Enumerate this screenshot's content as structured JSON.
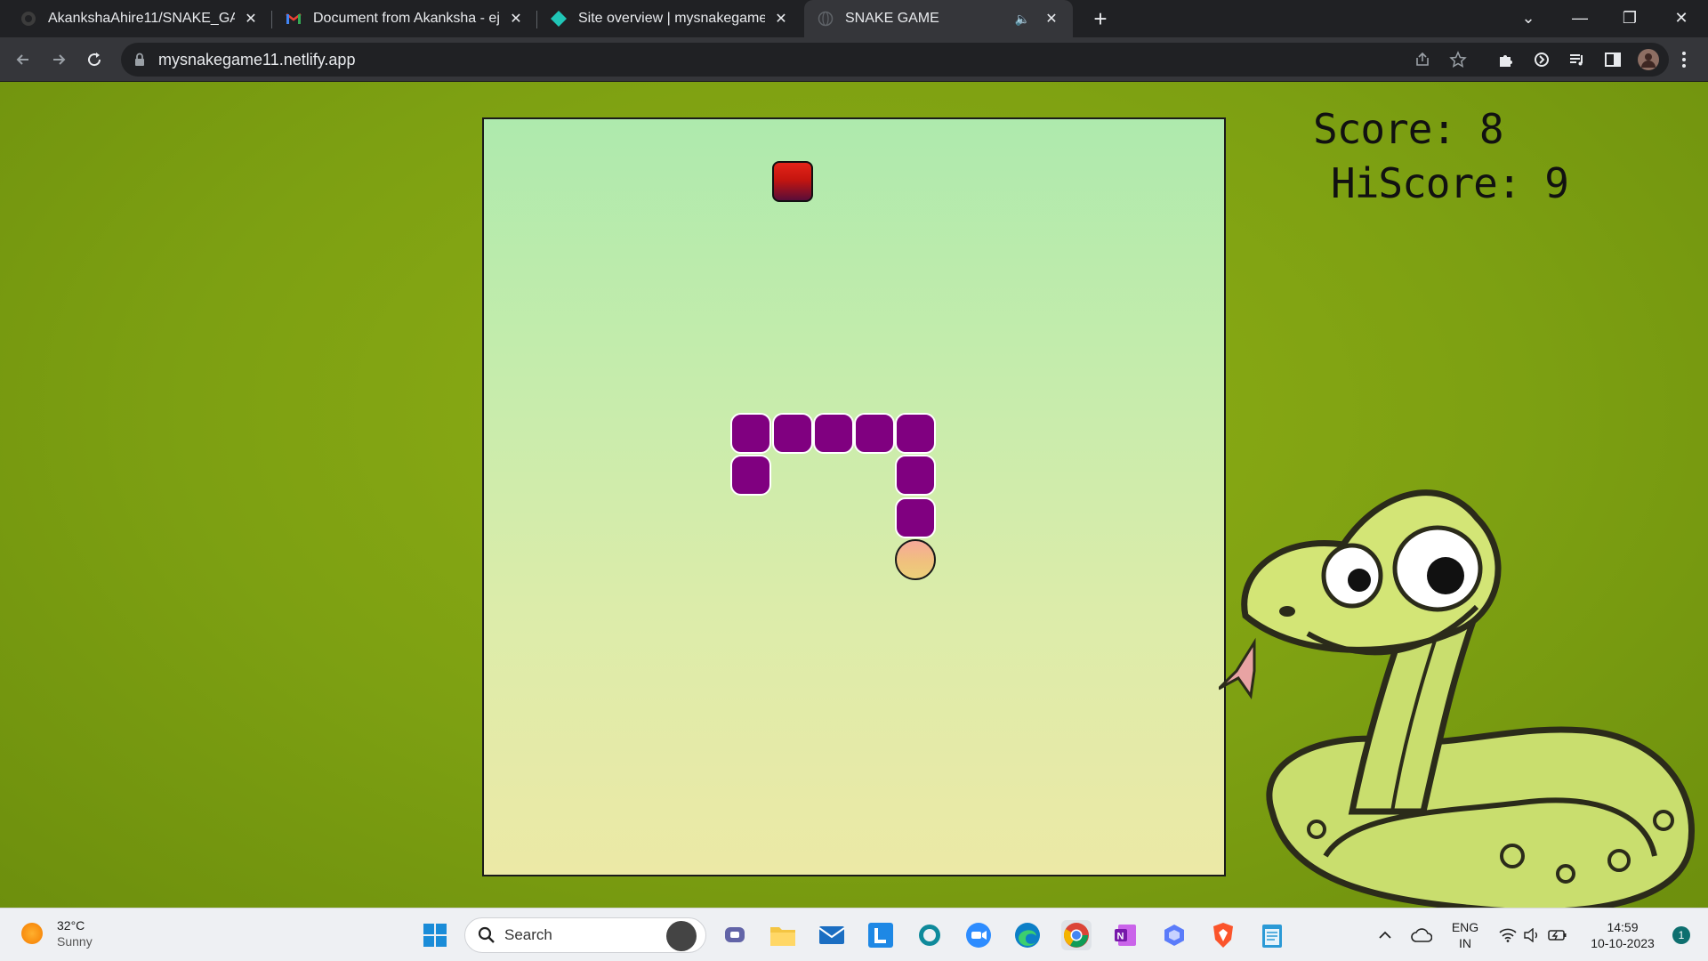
{
  "browser": {
    "tabs": [
      {
        "title": "AkankshaAhire11/SNAKE_GAME",
        "icon": "github-icon",
        "active": false
      },
      {
        "title": "Document from Akanksha - ejas",
        "icon": "gmail-icon",
        "active": false
      },
      {
        "title": "Site overview | mysnakegame11",
        "icon": "netlify-icon",
        "active": false
      },
      {
        "title": "SNAKE GAME",
        "icon": "globe-icon",
        "active": true,
        "audio": true
      }
    ],
    "url": "mysnakegame11.netlify.app"
  },
  "game": {
    "score_text": "Score: 8",
    "hiscore_text": "HiScore: 9",
    "score": 8,
    "hiscore": 9,
    "grid_size": 18,
    "food": {
      "col": 8,
      "row": 2
    },
    "snake": [
      {
        "col": 11,
        "row": 11,
        "part": "head"
      },
      {
        "col": 11,
        "row": 10
      },
      {
        "col": 11,
        "row": 9
      },
      {
        "col": 11,
        "row": 8
      },
      {
        "col": 10,
        "row": 8
      },
      {
        "col": 9,
        "row": 8
      },
      {
        "col": 8,
        "row": 8
      },
      {
        "col": 7,
        "row": 8
      },
      {
        "col": 7,
        "row": 9
      }
    ],
    "colors": {
      "snake_body": "#800080",
      "food": "#c5150f",
      "page_bg": "#7da012"
    }
  },
  "taskbar": {
    "weather": {
      "temp": "32°C",
      "condition": "Sunny"
    },
    "search_placeholder": "Search",
    "language": {
      "line1": "ENG",
      "line2": "IN"
    },
    "clock": {
      "time": "14:59",
      "date": "10-10-2023"
    },
    "notification_count": "1"
  }
}
